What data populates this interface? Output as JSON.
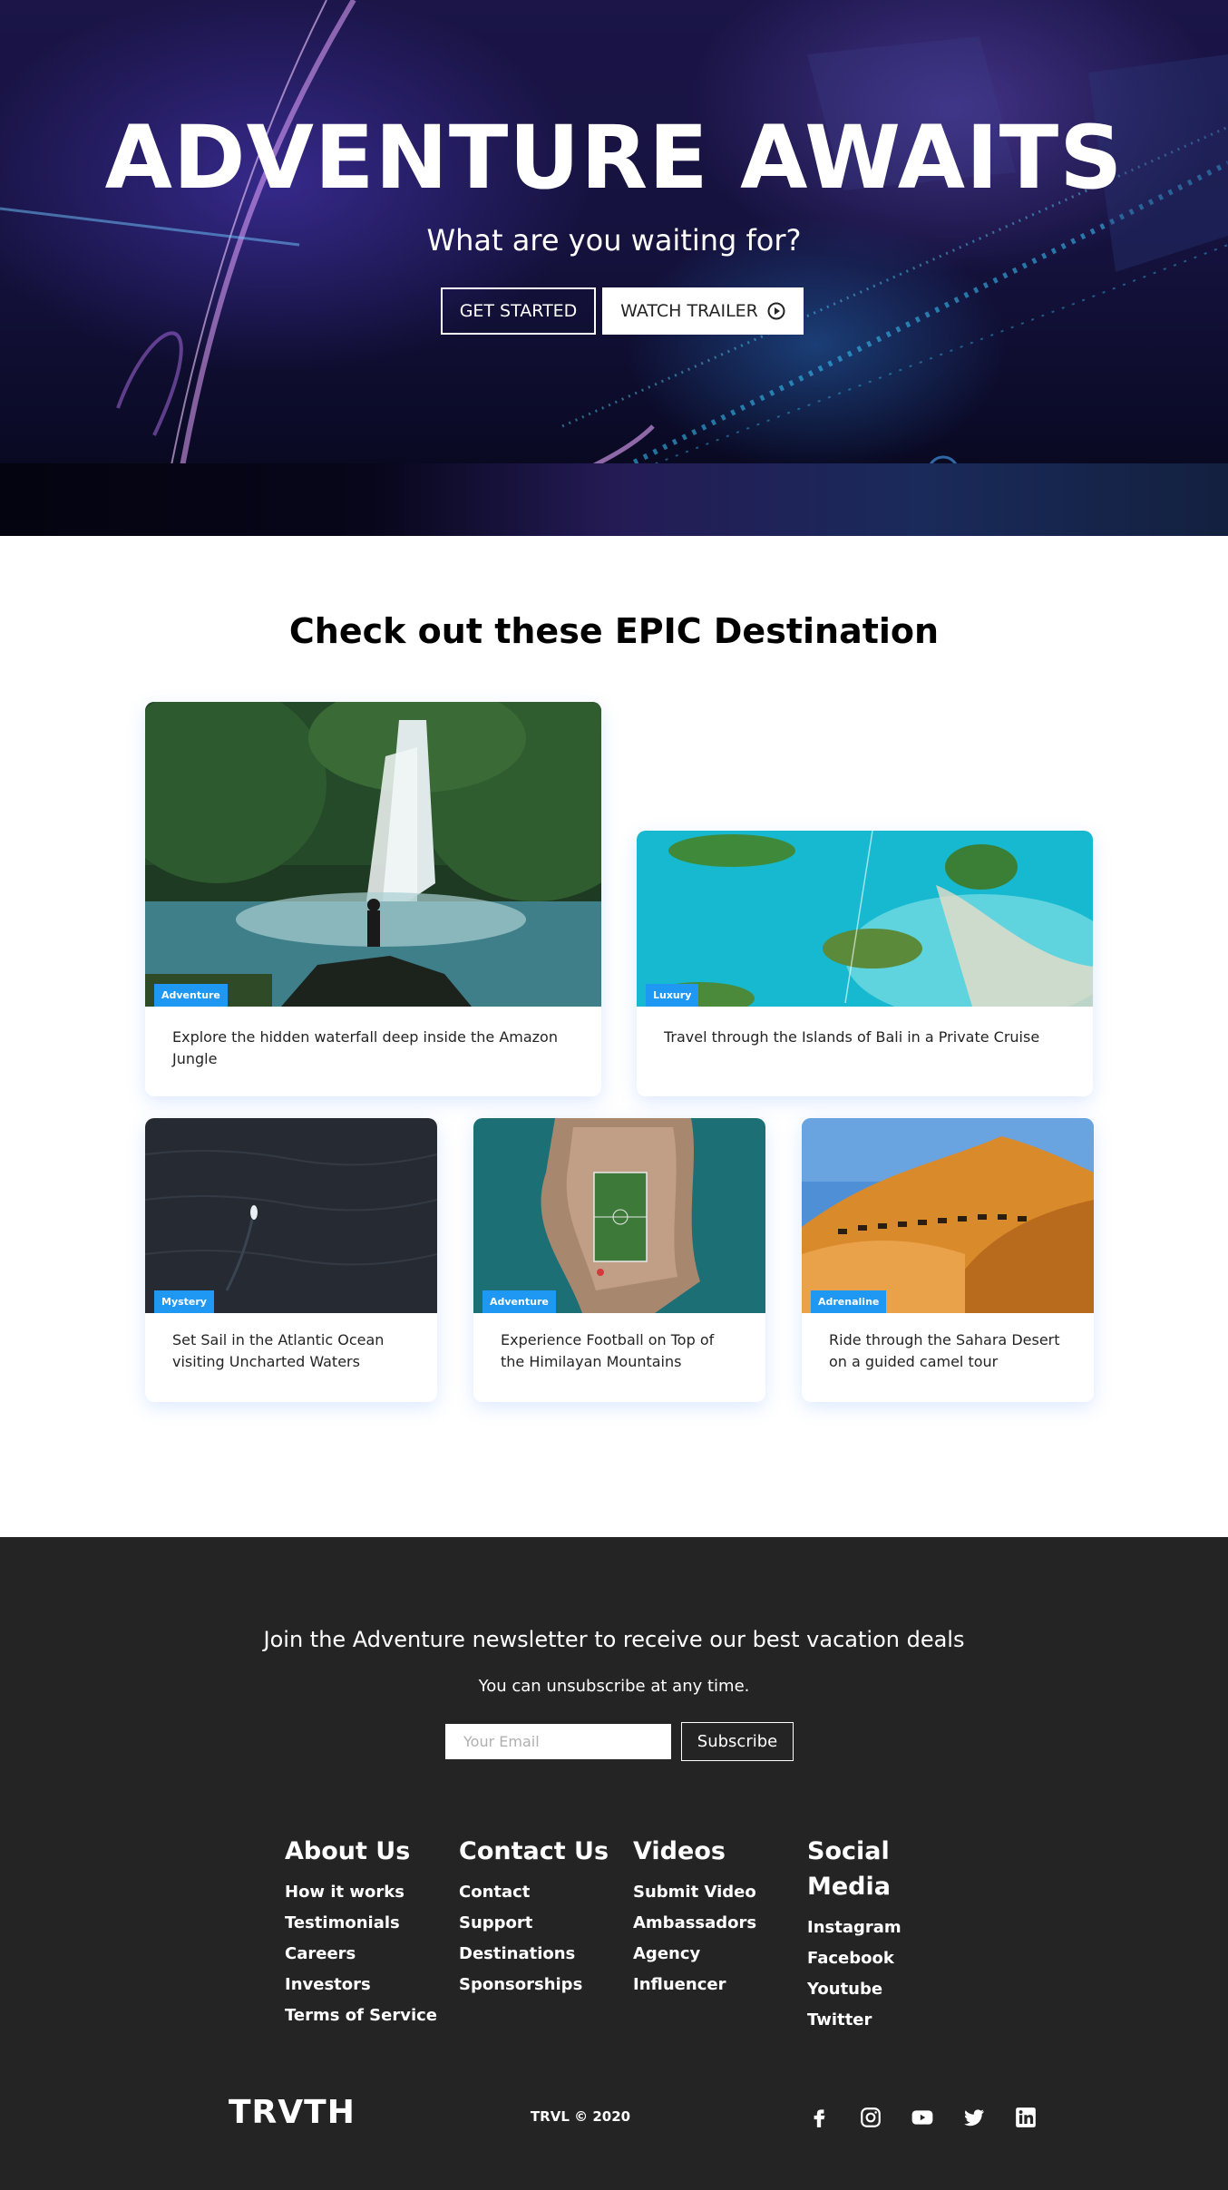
{
  "hero": {
    "title": "ADVENTURE AWAITS",
    "subtitle": "What are you waiting for?",
    "get_started": "GET STARTED",
    "watch_trailer": "WATCH TRAILER"
  },
  "destinations": {
    "heading": "Check out these EPIC Destination",
    "cards": [
      {
        "tag": "Adventure",
        "text": "Explore the hidden waterfall deep inside the Amazon Jungle"
      },
      {
        "tag": "Luxury",
        "text": "Travel through the Islands of Bali in a Private Cruise"
      },
      {
        "tag": "Mystery",
        "text": "Set Sail in the Atlantic Ocean visiting Uncharted Waters"
      },
      {
        "tag": "Adventure",
        "text": "Experience Football on Top of the Himilayan Mountains"
      },
      {
        "tag": "Adrenaline",
        "text": "Ride through the Sahara Desert on a guided camel tour"
      }
    ]
  },
  "newsletter": {
    "heading": "Join the Adventure newsletter to receive our best vacation deals",
    "subheading": "You can unsubscribe at any time.",
    "placeholder": "Your Email",
    "button": "Subscribe"
  },
  "footer": {
    "columns": [
      {
        "title": "About Us",
        "links": [
          "How it works",
          "Testimonials",
          "Careers",
          "Investors",
          "Terms of Service"
        ]
      },
      {
        "title": "Contact Us",
        "links": [
          "Contact",
          "Support",
          "Destinations",
          "Sponsorships"
        ]
      },
      {
        "title": "Videos",
        "links": [
          "Submit Video",
          "Ambassadors",
          "Agency",
          "Influencer"
        ]
      },
      {
        "title": "Social Media",
        "links": [
          "Instagram",
          "Facebook",
          "Youtube",
          "Twitter"
        ]
      }
    ],
    "logo": "TRVTH",
    "copyright": "TRVL © 2020",
    "social_icons": [
      "facebook-icon",
      "instagram-icon",
      "youtube-icon",
      "twitter-icon",
      "linkedin-icon"
    ]
  },
  "colors": {
    "tag_blue": "#1f98f4",
    "footer_bg": "#242424",
    "hero_bg": "#1b1548"
  }
}
